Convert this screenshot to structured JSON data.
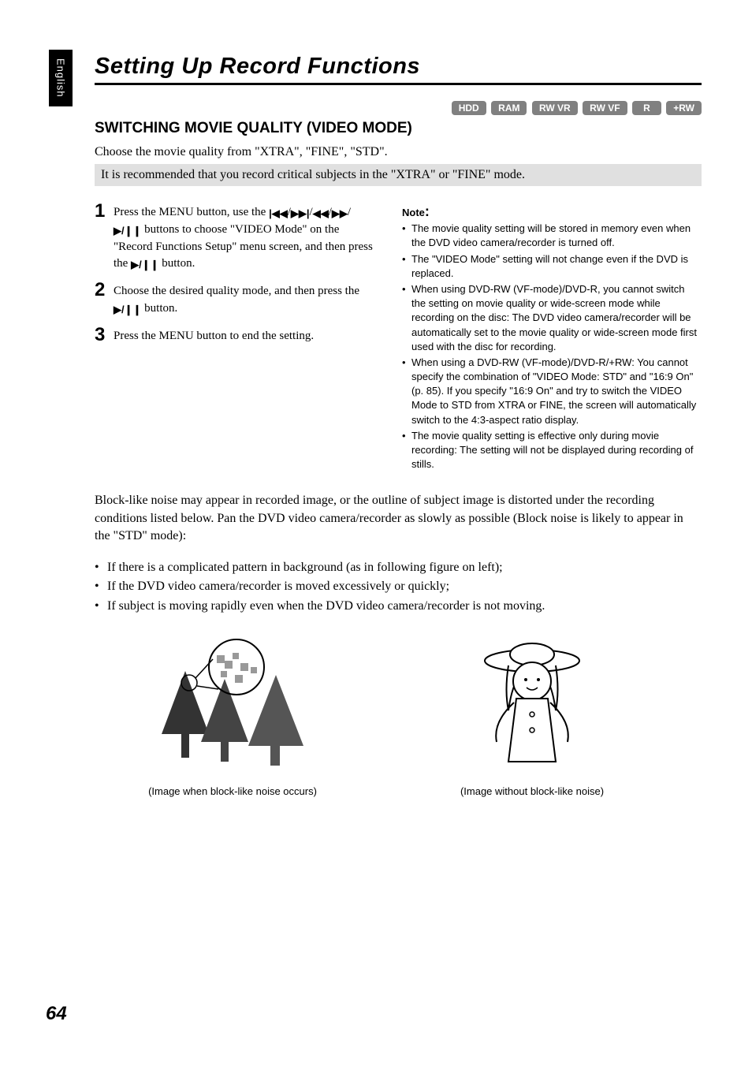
{
  "sidebar_label": "English",
  "title": "Setting Up Record Functions",
  "badges": [
    "HDD",
    "RAM",
    "RW VR",
    "RW VF",
    "R",
    "+RW"
  ],
  "section_heading": "SWITCHING MOVIE QUALITY (VIDEO MODE)",
  "intro": "Choose the movie quality from \"XTRA\", \"FINE\", \"STD\".",
  "callout": "It is recommended that you record critical subjects in the \"XTRA\" or \"FINE\" mode.",
  "steps": [
    {
      "num": "1",
      "pre": "Press the MENU button, use the ",
      "mid": " buttons to choose \"VIDEO Mode\" on the \"Record Functions Setup\" menu screen, and then press the ",
      "post": " button."
    },
    {
      "num": "2",
      "pre": "Choose the desired quality mode, and then press the ",
      "post": " button."
    },
    {
      "num": "3",
      "text": "Press the MENU button to end the setting."
    }
  ],
  "note_label": "Note",
  "notes": [
    "The movie quality setting will be stored in memory even when the DVD video camera/recorder is turned off.",
    "The \"VIDEO Mode\" setting will not change even if the DVD is replaced.",
    "When using DVD-RW (VF-mode)/DVD-R, you cannot switch the setting on movie quality or wide-screen mode while recording on the disc: The DVD video camera/recorder will be automatically set to the movie quality or wide-screen mode first used with the disc for recording.",
    "When using a DVD-RW (VF-mode)/DVD-R/+RW: You cannot specify the combination of \"VIDEO Mode: STD\" and \"16:9 On\"(p. 85). If you specify \"16:9 On\" and try to switch the VIDEO Mode to STD from XTRA or FINE, the screen will automatically switch to the 4:3-aspect ratio display.",
    "The movie quality setting is effective only during movie recording: The setting will not be displayed during recording of stills."
  ],
  "block_text": "Block-like noise may appear in recorded image, or the outline of subject image is distorted under the recording conditions listed below. Pan the DVD video camera/recorder as slowly as possible (Block noise is likely to appear in the \"STD\" mode):",
  "conditions": [
    "If there is a complicated pattern in background (as in following figure on left);",
    "If the DVD video camera/recorder is moved excessively or quickly;",
    "If subject is moving rapidly even when the DVD video camera/recorder is not moving."
  ],
  "caption_left": "(Image when block-like noise occurs)",
  "caption_right": "(Image without block-like noise)",
  "page_number": "64",
  "icons": {
    "skip_back": "|◀◀",
    "skip_fwd": "▶▶|",
    "rew": "◀◀",
    "ffwd": "▶▶",
    "play_pause": "▶/❙❙"
  }
}
